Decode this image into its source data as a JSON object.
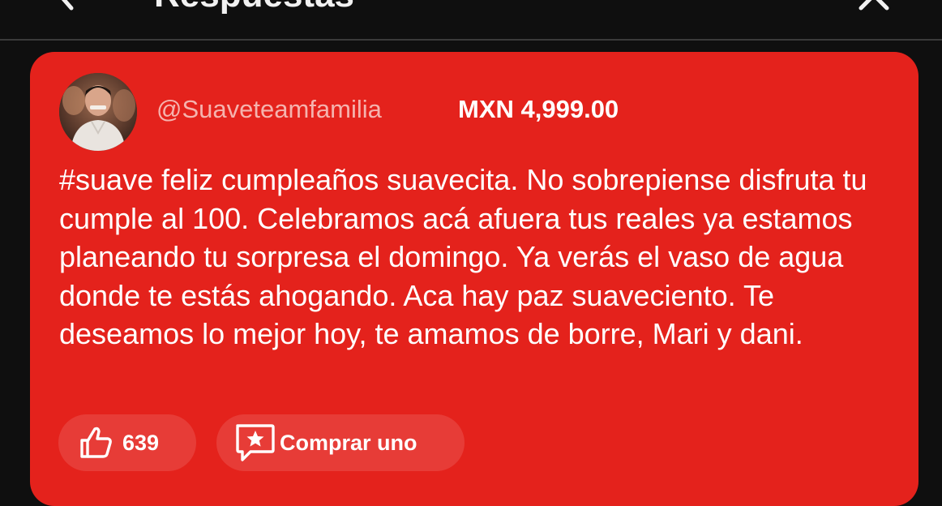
{
  "header": {
    "title": "Respuestas",
    "back_icon": "chevron-left-icon",
    "close_icon": "close-icon"
  },
  "comment": {
    "username": "@Suaveteamfamilia",
    "amount": "MXN 4,999.00",
    "message": "#suave feliz cumpleaños suavecita. No sobrepiense disfruta tu cumple al 100. Celebramos acá afuera tus reales ya estamos planeando tu sorpresa el domingo. Ya verás el vaso de agua donde te estás ahogando. Aca hay paz suaveciento. Te deseamos lo mejor hoy, te amamos de borre, Mari y dani.",
    "card_color": "#e4221c"
  },
  "actions": {
    "like_count": "639",
    "like_icon": "thumbs-up-icon",
    "buy_label": "Comprar uno",
    "buy_icon": "super-chat-star-icon"
  }
}
